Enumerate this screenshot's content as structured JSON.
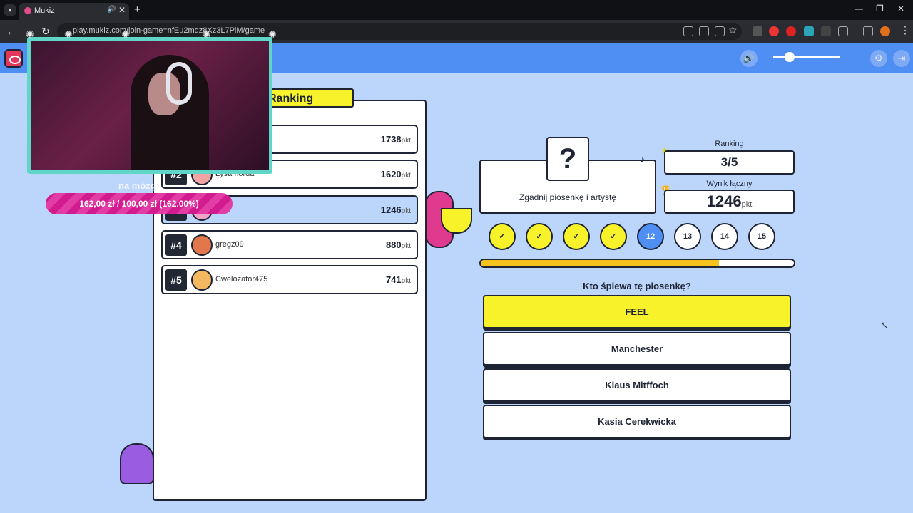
{
  "browser": {
    "tab_title": "Mukiz",
    "url": "play.mukiz.com/join-game=nfEu2mqz8Xz3L7PlM/game"
  },
  "overlay": {
    "label": "na mózg",
    "donation": "162,00 zł / 100,00 zł (162.00%)"
  },
  "ranking": {
    "title": "Ranking",
    "unit": "pkt",
    "rows": [
      {
        "pos": "#1",
        "name": "",
        "points": "1738"
      },
      {
        "pos": "#2",
        "name": "Łysamorda",
        "points": "1620"
      },
      {
        "pos": "#3",
        "name": "",
        "points": "1246"
      },
      {
        "pos": "#4",
        "name": "gregz09",
        "points": "880"
      },
      {
        "pos": "#5",
        "name": "Cwelozator475",
        "points": "741"
      }
    ]
  },
  "round": {
    "card_label": "Zgadnij piosenkę i artystę",
    "question_mark": "?",
    "ranking_label": "Ranking",
    "ranking_value": "3/5",
    "score_label": "Wynik łączny",
    "score_value": "1246",
    "score_unit": "pkt",
    "progress": [
      "✓",
      "✓",
      "✓",
      "✓",
      "12",
      "13",
      "14",
      "15"
    ],
    "timer_fraction": 0.76,
    "question": "Kto śpiewa tę piosenkę?",
    "answers": [
      "FEEL",
      "Manchester",
      "Klaus Mitffoch",
      "Kasia Cerekwicka"
    ]
  },
  "colors": {
    "primary": "#4f8ef2",
    "accent": "#f7f229",
    "background": "#bcd6fb",
    "timer": "#f6c31d",
    "donation": "#d21b8f"
  }
}
